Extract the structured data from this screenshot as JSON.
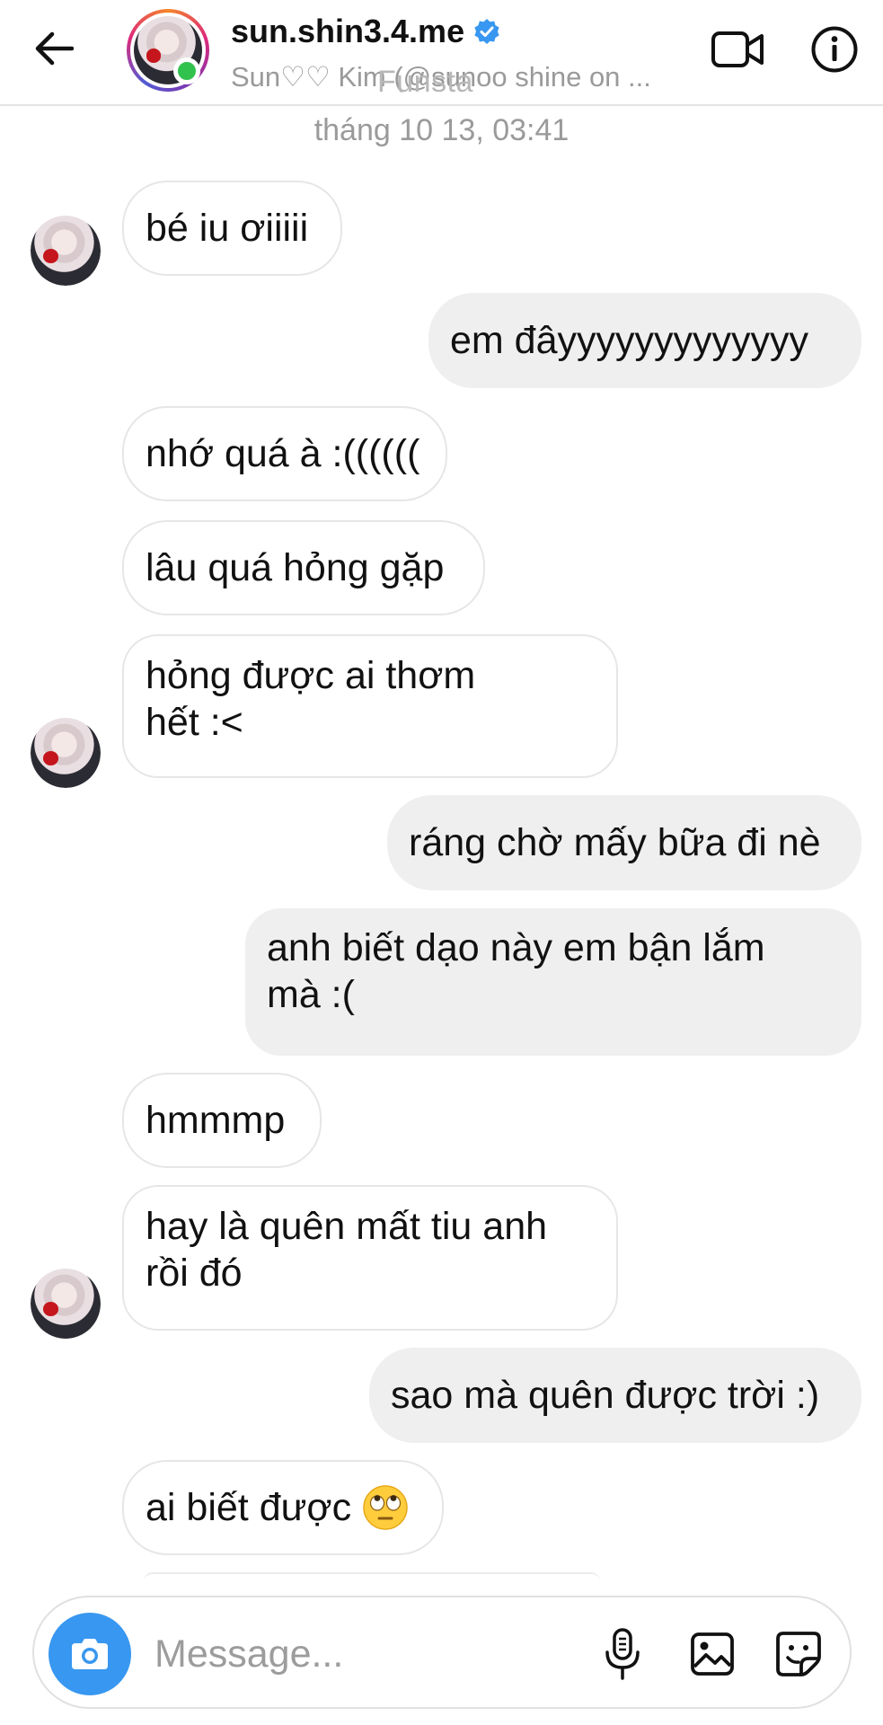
{
  "header": {
    "username": "sun.shin3.4.me",
    "subtitle": "Sun♡♡ Kim (@sunoo shine on ...",
    "overlay": "Funsta",
    "icons": {
      "back": "arrow-left-icon",
      "verified": "verified-badge-icon",
      "video": "video-call-icon",
      "info": "info-icon"
    },
    "colors": {
      "verified": "#3897f0",
      "online": "#31c24d"
    }
  },
  "chat": {
    "timestamp": "tháng 10 13, 03:41",
    "messages": [
      {
        "side": "in",
        "text": "bé iu ơiiiii"
      },
      {
        "side": "out",
        "text": "em đâyyyyyyyyyyyyy"
      },
      {
        "side": "in",
        "text": "nhớ quá à :(((((("
      },
      {
        "side": "in",
        "text": "lâu quá hỏng gặp"
      },
      {
        "side": "in",
        "text": "hỏng được ai thơm hết :<"
      },
      {
        "side": "out",
        "text": "ráng chờ mấy bữa đi nè"
      },
      {
        "side": "out",
        "text": "anh biết dạo này em bận lắm mà :("
      },
      {
        "side": "in",
        "text": "hmmmp"
      },
      {
        "side": "in",
        "text": "hay là quên mất tiu anh rồi đó"
      },
      {
        "side": "out",
        "text": "sao mà quên được trời :)"
      },
      {
        "side": "in",
        "text": "ai biết được",
        "emoji": "eye-roll-emoji-icon"
      }
    ],
    "colors": {
      "incoming_bg": "#ffffff",
      "outgoing_bg": "#efefef"
    }
  },
  "composer": {
    "placeholder": "Message...",
    "value": "",
    "icons": {
      "camera": "camera-icon",
      "mic": "microphone-icon",
      "gallery": "gallery-icon",
      "sticker": "sticker-icon"
    },
    "colors": {
      "camera_bg": "#3897f0"
    }
  }
}
